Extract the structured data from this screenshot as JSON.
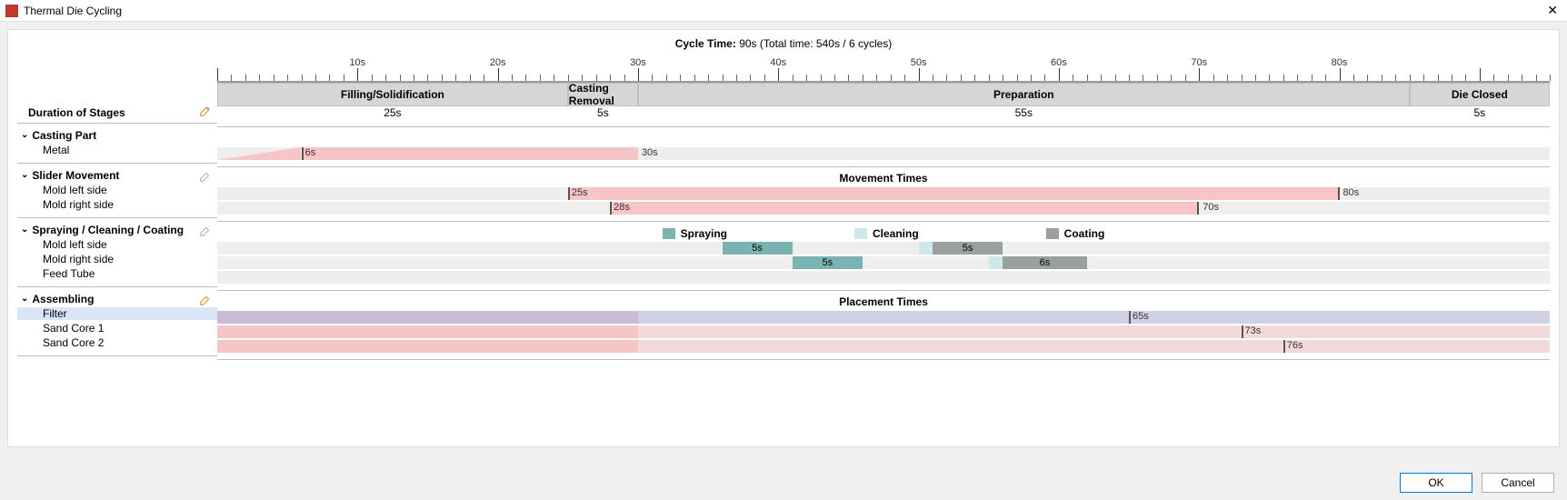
{
  "window": {
    "title": "Thermal Die Cycling"
  },
  "cycle": {
    "label": "Cycle Time:",
    "value": "90s",
    "detail": "(Total time: 540s / 6 cycles)"
  },
  "ruler": {
    "ticks": [
      "10s",
      "20s",
      "30s",
      "40s",
      "50s",
      "60s",
      "70s",
      "80s"
    ],
    "max_s": 95
  },
  "stages": {
    "header": "",
    "items": [
      {
        "label": "Filling/Solidification",
        "start": 0,
        "span": 25,
        "dur": "25s"
      },
      {
        "label": "Casting Removal",
        "start": 25,
        "span": 5,
        "dur": "5s"
      },
      {
        "label": "Preparation",
        "start": 30,
        "span": 55,
        "dur": "55s"
      },
      {
        "label": "Die Closed",
        "start": 85,
        "span": 10,
        "dur": "5s"
      }
    ],
    "duration_label": "Duration of Stages"
  },
  "sections": {
    "casting": {
      "title": "Casting Part",
      "rows": [
        {
          "label": "Metal",
          "ramp_end": 6,
          "bar_end": 30,
          "start_lbl": "6s",
          "end_lbl": "30s"
        }
      ]
    },
    "slider": {
      "title": "Slider Movement",
      "subtitle": "Movement Times",
      "rows": [
        {
          "label": "Mold left side",
          "start": 25,
          "end": 80,
          "start_lbl": "25s",
          "end_lbl": "80s"
        },
        {
          "label": "Mold right side",
          "start": 28,
          "end": 70,
          "start_lbl": "28s",
          "end_lbl": "70s"
        }
      ]
    },
    "spray": {
      "title": "Spraying / Cleaning / Coating",
      "legend": {
        "spraying": "Spraying",
        "cleaning": "Cleaning",
        "coating": "Coating"
      },
      "rows": [
        {
          "label": "Mold left side",
          "spray": {
            "start": 36,
            "span": 5,
            "lbl": "5s"
          },
          "clean": {
            "start": 51,
            "span": 5,
            "lbl": "5s"
          }
        },
        {
          "label": "Mold right side",
          "spray": {
            "start": 41,
            "span": 5,
            "lbl": "5s"
          },
          "clean": {
            "start": 56,
            "span": 6,
            "lbl": "6s"
          }
        },
        {
          "label": "Feed Tube"
        }
      ]
    },
    "assembling": {
      "title": "Assembling",
      "subtitle": "Placement Times",
      "rows": [
        {
          "label": "Filter",
          "solid_end": 30,
          "marker": 65,
          "marker_lbl": "65s",
          "selected": true
        },
        {
          "label": "Sand Core 1",
          "solid_end": 30,
          "marker": 73,
          "marker_lbl": "73s"
        },
        {
          "label": "Sand Core 2",
          "solid_end": 30,
          "marker": 76,
          "marker_lbl": "76s"
        }
      ]
    }
  },
  "buttons": {
    "ok": "OK",
    "cancel": "Cancel"
  },
  "chart_data": {
    "type": "gantt",
    "x_unit": "s",
    "x_range": [
      0,
      95
    ],
    "cycle_time_s": 90,
    "total_time_s": 540,
    "cycles": 6,
    "stages": [
      {
        "name": "Filling/Solidification",
        "start": 0,
        "duration": 25
      },
      {
        "name": "Casting Removal",
        "start": 25,
        "duration": 5
      },
      {
        "name": "Preparation",
        "start": 30,
        "duration": 55
      },
      {
        "name": "Die Closed",
        "start": 85,
        "duration": 5
      }
    ],
    "tracks": [
      {
        "group": "Casting Part",
        "name": "Metal",
        "segments": [
          {
            "type": "ramp",
            "start": 0,
            "end": 6
          },
          {
            "type": "fill",
            "start": 6,
            "end": 30
          }
        ]
      },
      {
        "group": "Slider Movement",
        "name": "Mold left side",
        "segments": [
          {
            "type": "open",
            "start": 25,
            "end": 80
          }
        ]
      },
      {
        "group": "Slider Movement",
        "name": "Mold right side",
        "segments": [
          {
            "type": "open",
            "start": 28,
            "end": 70
          }
        ]
      },
      {
        "group": "Spraying / Cleaning / Coating",
        "name": "Mold left side",
        "segments": [
          {
            "type": "spraying",
            "start": 36,
            "end": 41
          },
          {
            "type": "cleaning",
            "start": 51,
            "end": 56
          }
        ]
      },
      {
        "group": "Spraying / Cleaning / Coating",
        "name": "Mold right side",
        "segments": [
          {
            "type": "spraying",
            "start": 41,
            "end": 46
          },
          {
            "type": "cleaning",
            "start": 56,
            "end": 62
          }
        ]
      },
      {
        "group": "Spraying / Cleaning / Coating",
        "name": "Feed Tube",
        "segments": []
      },
      {
        "group": "Assembling",
        "name": "Filter",
        "segments": [
          {
            "type": "placed",
            "start": 0,
            "end": 30
          },
          {
            "type": "placement-time",
            "at": 65
          }
        ]
      },
      {
        "group": "Assembling",
        "name": "Sand Core 1",
        "segments": [
          {
            "type": "placed",
            "start": 0,
            "end": 30
          },
          {
            "type": "placement-time",
            "at": 73
          }
        ]
      },
      {
        "group": "Assembling",
        "name": "Sand Core 2",
        "segments": [
          {
            "type": "placed",
            "start": 0,
            "end": 30
          },
          {
            "type": "placement-time",
            "at": 76
          }
        ]
      }
    ]
  }
}
